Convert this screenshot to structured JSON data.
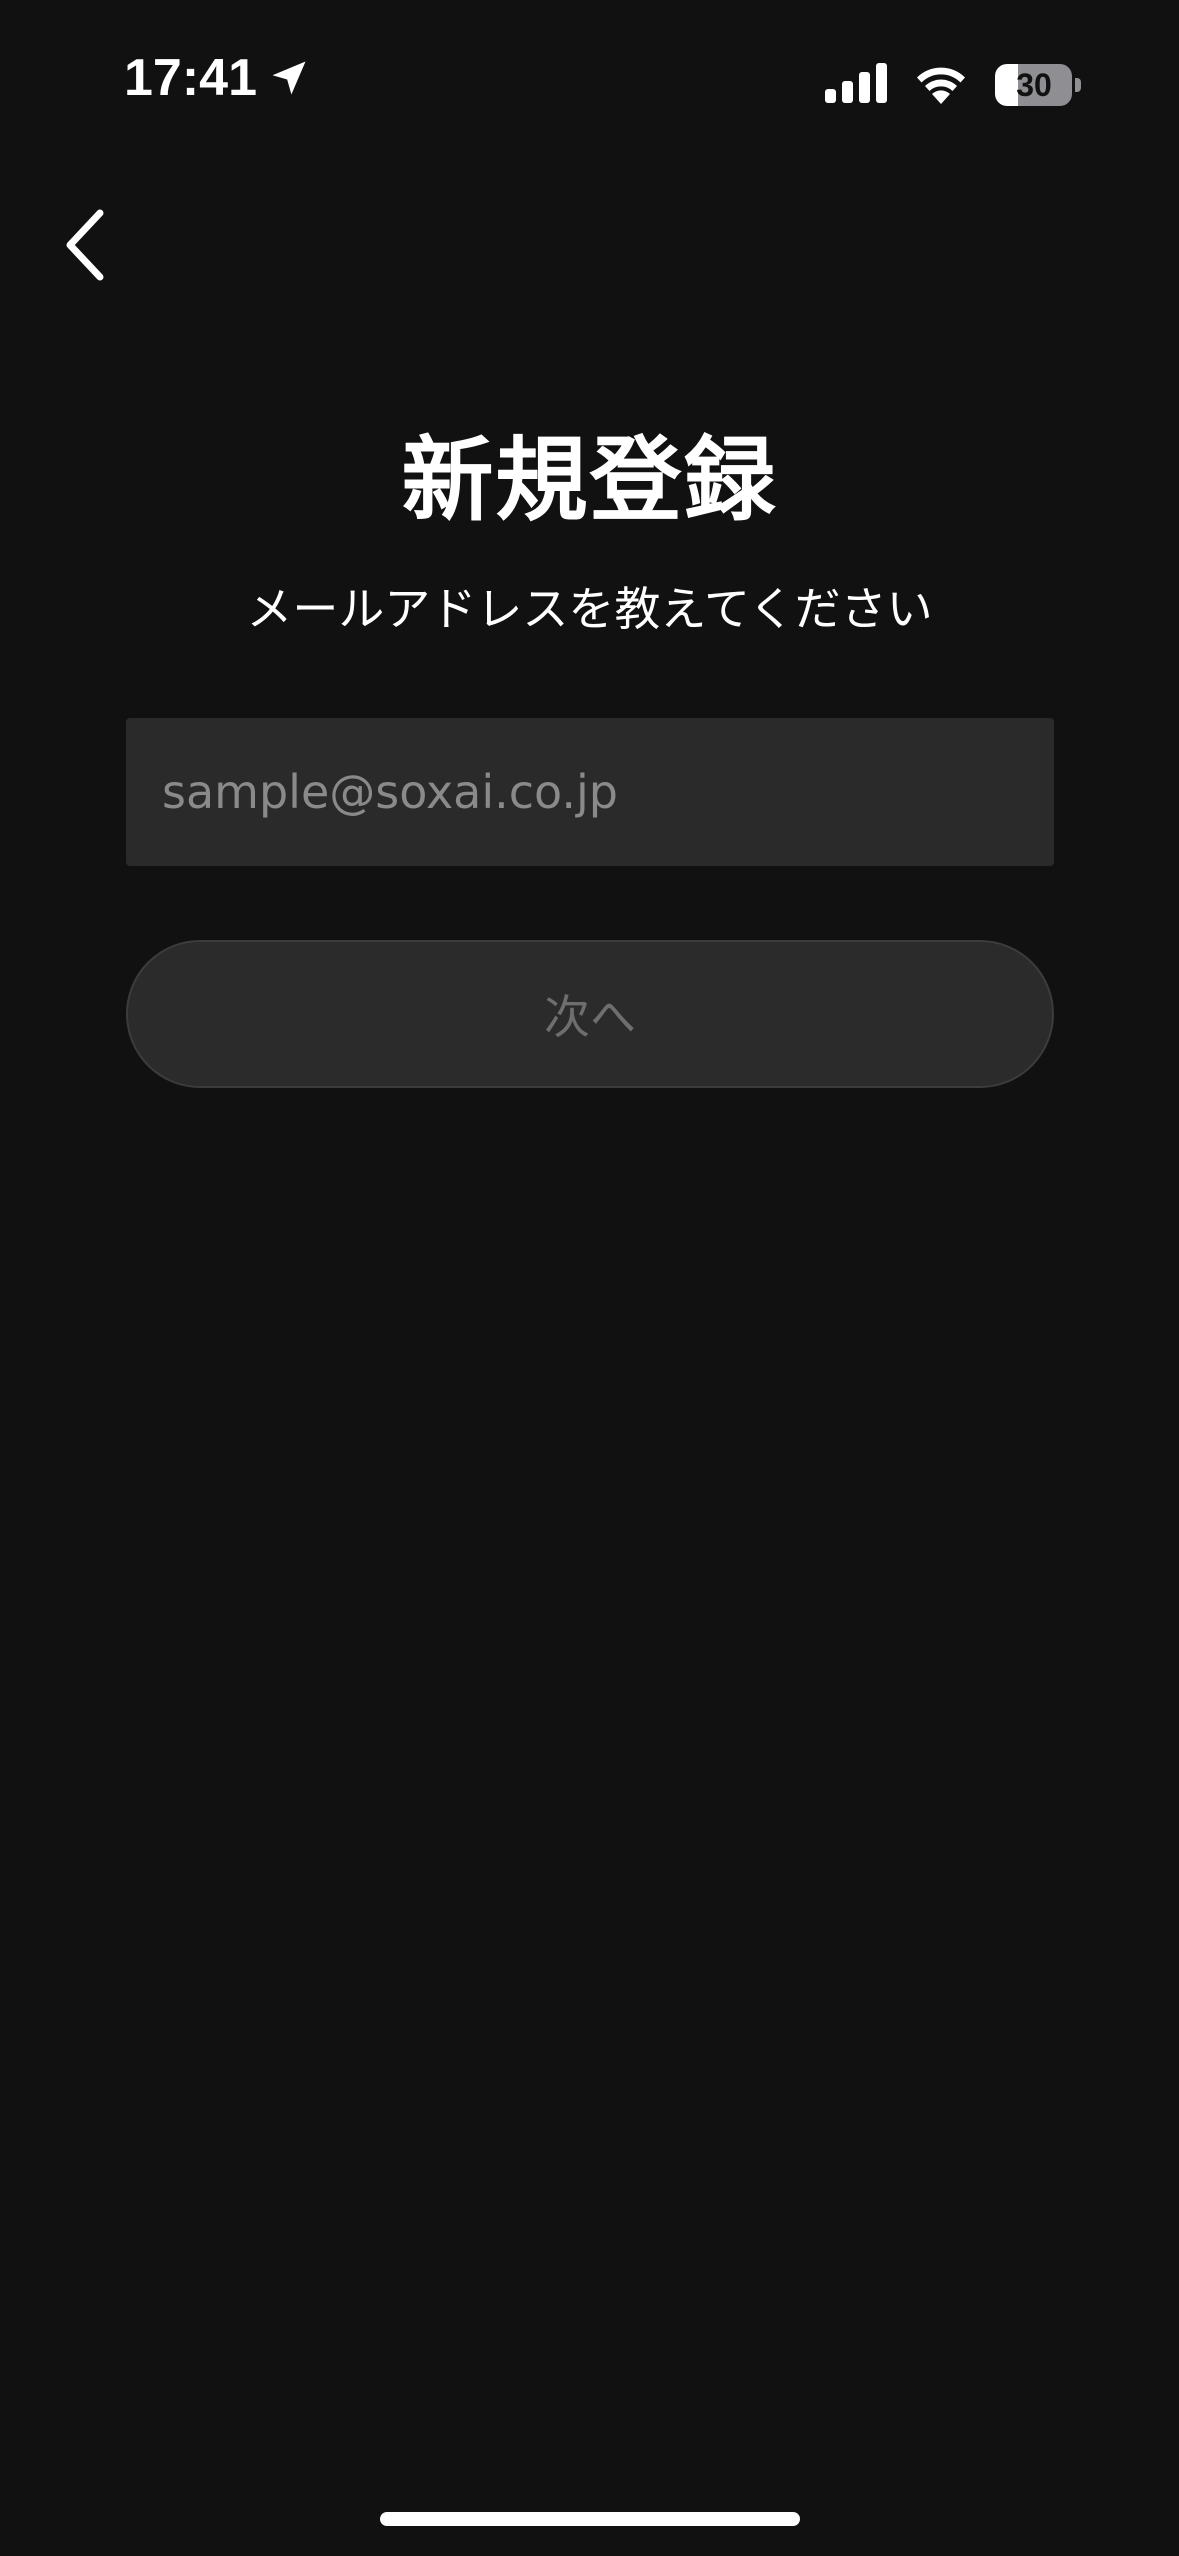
{
  "status_bar": {
    "time": "17:41",
    "battery_level": "30",
    "battery_fraction": 0.3,
    "icons": [
      "location-arrow-icon",
      "cellular-signal-icon",
      "wifi-icon",
      "battery-icon"
    ]
  },
  "navigation": {
    "back_icon": "chevron-left-icon"
  },
  "main": {
    "title": "新規登録",
    "subtitle": "メールアドレスを教えてください",
    "email_field": {
      "value": "",
      "placeholder": "sample@soxai.co.jp"
    },
    "next_button_label": "次へ"
  },
  "colors": {
    "background": "#111111",
    "input_background": "#2a2a2a",
    "button_background": "#2b2b2b",
    "button_text_disabled": "#6e6e6e",
    "placeholder": "#8a8a8a"
  }
}
